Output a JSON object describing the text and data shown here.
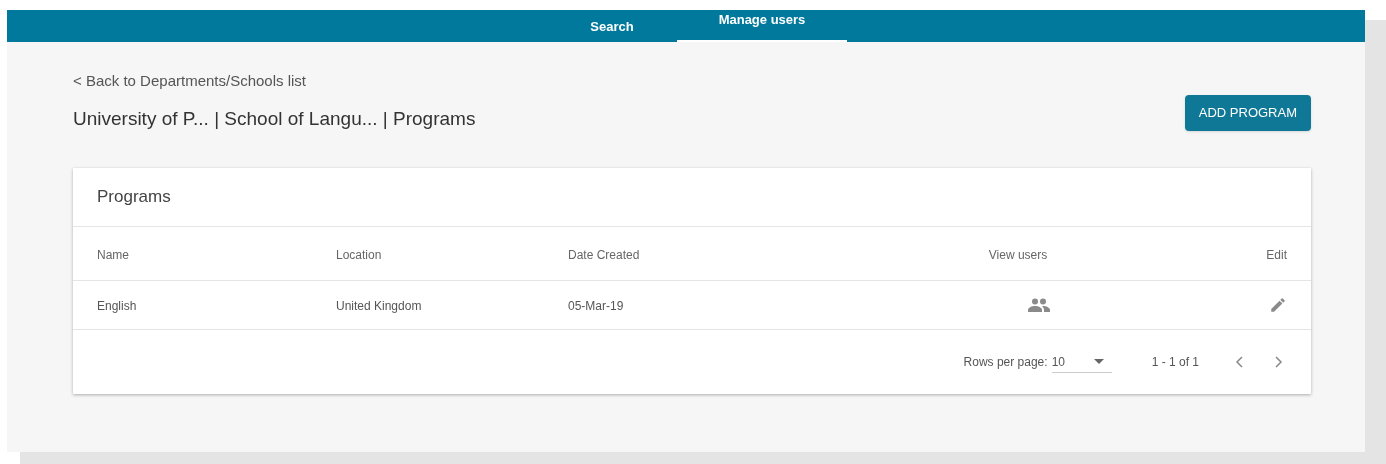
{
  "nav_tabs": [
    {
      "label": "Search",
      "selected": false
    },
    {
      "label": "Manage users",
      "selected": true
    }
  ],
  "back_link": "< Back to Departments/Schools list",
  "breadcrumb": "University of P... | School of Langu... | Programs",
  "add_button": "ADD PROGRAM",
  "card_title": "Programs",
  "table": {
    "columns": [
      "Name",
      "Location",
      "Date Created",
      "View users",
      "Edit"
    ],
    "rows": [
      {
        "name": "English",
        "location": "United Kingdom",
        "date_created": "05-Mar-19"
      }
    ]
  },
  "pagination": {
    "rows_per_page_label": "Rows per page:",
    "rows_per_page": "10",
    "range": "1 - 1 of 1"
  }
}
